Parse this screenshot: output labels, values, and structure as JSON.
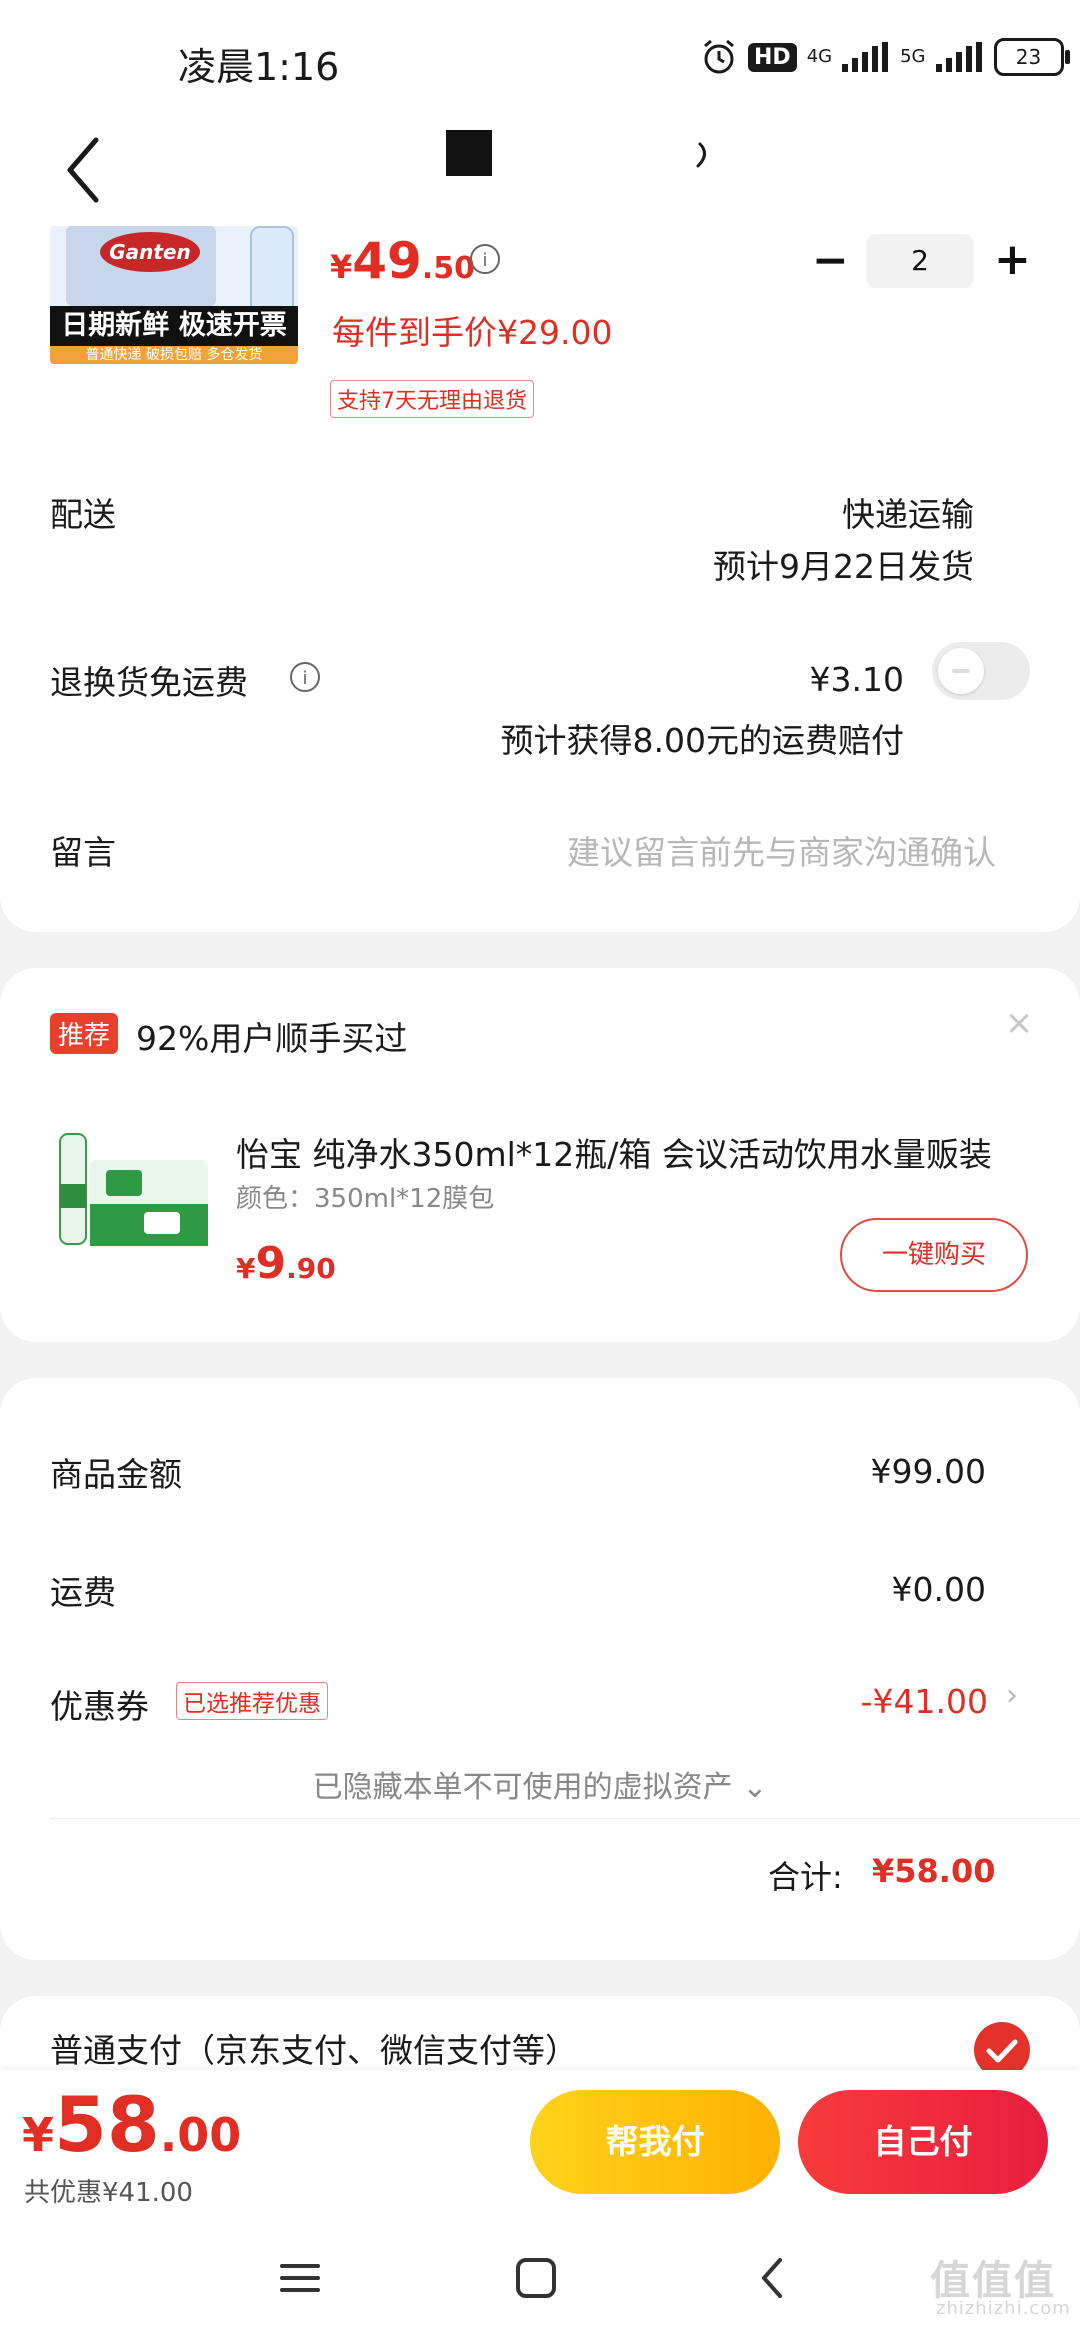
{
  "status_bar": {
    "time": "凌晨1:16",
    "hd_badge": "HD",
    "net1": "4G",
    "net2": "5G",
    "battery": "23"
  },
  "product": {
    "image_banner": "日期新鲜 极速开票",
    "image_subbanner": "普通快递 破损包赔 多仓发货",
    "image_brand": "Ganten",
    "price_currency": "¥",
    "price_int": "49",
    "price_dec": ".50",
    "unit_price": "每件到手价¥29.00",
    "return_tag": "支持7天无理由退货",
    "quantity": "2"
  },
  "delivery": {
    "label": "配送",
    "method": "快递运输",
    "eta": "预计9月22日发货"
  },
  "return_shipping": {
    "label": "退换货免运费",
    "price": "¥3.10",
    "note": "预计获得8.00元的运费赔付",
    "enabled": false
  },
  "message": {
    "label": "留言",
    "placeholder": "建议留言前先与商家沟通确认"
  },
  "recommend": {
    "tag": "推荐",
    "title": "92%用户顺手买过",
    "item_name": "怡宝 纯净水350ml*12瓶/箱 会议活动饮用水量贩装",
    "item_color": "颜色：350ml*12膜包",
    "price_currency": "¥",
    "price_int": "9",
    "price_dec": ".90",
    "buy_button": "一键购买"
  },
  "summary": {
    "goods_label": "商品金额",
    "goods_value": "¥99.00",
    "shipping_label": "运费",
    "shipping_value": "¥0.00",
    "coupon_label": "优惠券",
    "coupon_tag": "已选推荐优惠",
    "coupon_value": "-¥41.00",
    "hidden_assets": "已隐藏本单不可使用的虚拟资产",
    "total_label": "合计:",
    "total_value": "¥58.00"
  },
  "payment": {
    "method_label": "普通支付（京东支付、微信支付等）",
    "selected": true
  },
  "bottom_bar": {
    "total_currency": "¥",
    "total_int": "58",
    "total_dec": ".00",
    "saved": "共优惠¥41.00",
    "help_pay": "帮我付",
    "self_pay": "自己付"
  },
  "watermark": {
    "text": "值值值",
    "url": "zhizhizhi.com"
  },
  "colors": {
    "accent_red": "#e02e24",
    "help_button": "#ffc107",
    "self_button": "#f03040"
  }
}
